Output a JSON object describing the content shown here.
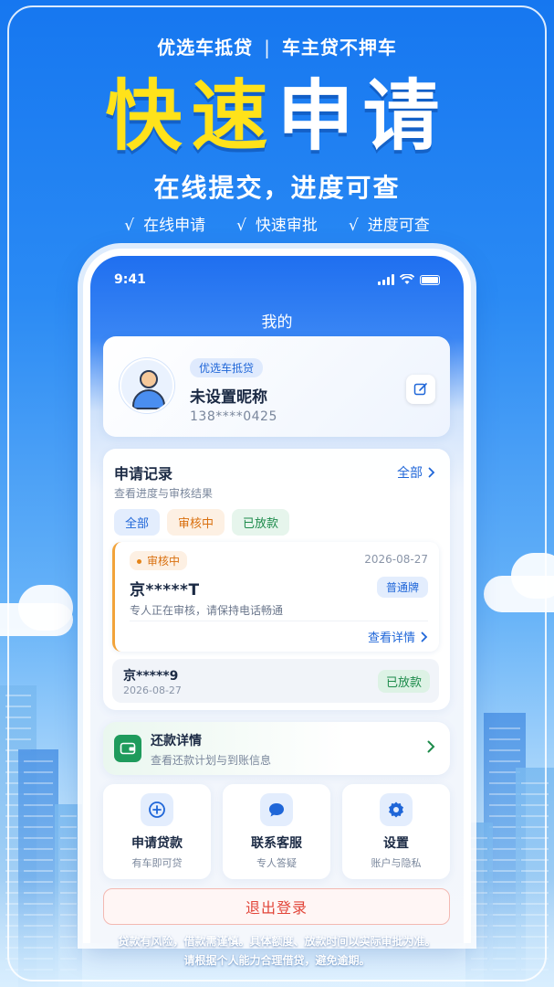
{
  "banner": {
    "brand": "优选车抵贷",
    "separator": "|",
    "tagline": "车主贷不押车",
    "hero_yellow": "快速",
    "hero_white": "申请",
    "subtitle": "在线提交，进度可查",
    "features": [
      {
        "check": "√",
        "label": "在线申请"
      },
      {
        "check": "√",
        "label": "快速审批"
      },
      {
        "check": "√",
        "label": "进度可查"
      }
    ]
  },
  "status_bar": {
    "time": "9:41"
  },
  "nav": {
    "title": "我的"
  },
  "profile": {
    "brand_pill": "优选车抵贷",
    "nickname": "未设置昵称",
    "phone": "138****0425",
    "edit_icon": "edit-icon"
  },
  "records": {
    "title": "申请记录",
    "subtitle": "查看进度与审核结果",
    "all_link": "全部",
    "filters": [
      "全部",
      "审核中",
      "已放款"
    ],
    "item1": {
      "status": "审核中",
      "date": "2026-08-27",
      "plate": "京*****T",
      "plate_type": "普通牌",
      "note": "专人正在审核，请保持电话畅通",
      "detail_link": "查看详情"
    },
    "item2": {
      "plate": "京*****9",
      "date": "2026-08-27",
      "status": "已放款"
    }
  },
  "repay": {
    "title": "还款详情",
    "subtitle": "查看还款计划与到账信息"
  },
  "tiles": [
    {
      "label": "申请贷款",
      "sub": "有车即可贷",
      "icon": "plus-circle-icon"
    },
    {
      "label": "联系客服",
      "sub": "专人答疑",
      "icon": "chat-bubble-icon"
    },
    {
      "label": "设置",
      "sub": "账户与隐私",
      "icon": "gear-icon"
    }
  ],
  "logout": {
    "label": "退出登录"
  },
  "disclaimer": {
    "line1": "贷款有风险，借款需谨慎。具体额度、放款时间以实际审批为准。",
    "line2": "请根据个人能力合理借贷，避免逾期。"
  },
  "colors": {
    "primary": "#1f66d8",
    "hero_yellow": "#ffe21a",
    "pending_orange": "#d9700f",
    "success_green": "#1d8b4b",
    "logout_red": "#e2463a"
  }
}
